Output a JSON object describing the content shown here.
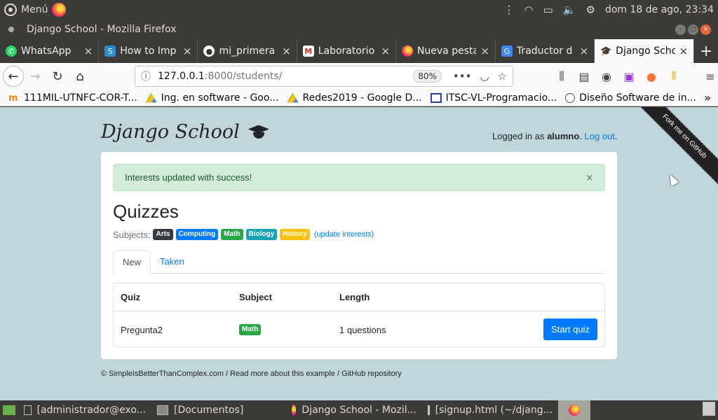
{
  "top_panel": {
    "menu_label": "Menú",
    "datetime": "dom 18 de ago, 23:34"
  },
  "window": {
    "title": "Django School - Mozilla Firefox"
  },
  "tabs": [
    {
      "label": "WhatsApp",
      "icon": "whatsapp-icon",
      "color": "#25d366"
    },
    {
      "label": "How to Imp",
      "icon": "stackoverflow-icon",
      "color": "#2d8cc8"
    },
    {
      "label": "mi_primera",
      "icon": "github-icon",
      "color": "#333333"
    },
    {
      "label": "Laboratorio",
      "icon": "gmail-icon",
      "color": "#d93025"
    },
    {
      "label": "Nueva pesta",
      "icon": "firefox-icon",
      "color": "#ff7139"
    },
    {
      "label": "Traductor d",
      "icon": "google-translate-icon",
      "color": "#4285f4"
    },
    {
      "label": "Django Scho",
      "icon": "graduation-cap-icon",
      "color": "#212529",
      "active": true
    }
  ],
  "urlbar": {
    "host": "127.0.0.1",
    "path": ":8000/students/",
    "zoom": "80%"
  },
  "bookmarks": [
    {
      "label": "111MIL-UTNFC-COR-T...",
      "icon": "moodle-icon"
    },
    {
      "label": "Ing. en software - Goo...",
      "icon": "google-drive-icon"
    },
    {
      "label": "Redes2019 - Google D...",
      "icon": "google-drive-icon"
    },
    {
      "label": "ITSC-VL-Programacio...",
      "icon": "calendar-icon"
    },
    {
      "label": "Diseño Software de in...",
      "icon": "globe-icon"
    }
  ],
  "page": {
    "brand": "Django School",
    "login_prefix": "Logged in as ",
    "username": "alumno",
    "login_sep": ". ",
    "logout": "Log out",
    "login_suffix": ".",
    "ribbon": "Fork me on GitHub",
    "alert": "Interests updated with success!",
    "alert_close": "×",
    "title": "Quizzes",
    "subjects_label": "Subjects:",
    "subjects": [
      {
        "name": "Arts",
        "color": "#343a40"
      },
      {
        "name": "Computing",
        "color": "#007bff"
      },
      {
        "name": "Math",
        "color": "#28a745"
      },
      {
        "name": "Biology",
        "color": "#17a2b8"
      },
      {
        "name": "History",
        "color": "#ffc107"
      }
    ],
    "update_interests": "(update interests)",
    "tabs": [
      {
        "label": "New",
        "active": true
      },
      {
        "label": "Taken",
        "active": false
      }
    ],
    "table": {
      "headers": [
        "Quiz",
        "Subject",
        "Length"
      ],
      "rows": [
        {
          "quiz": "Pregunta2",
          "subject": "Math",
          "subject_color": "#28a745",
          "length": "1 questions",
          "action": "Start quiz"
        }
      ]
    },
    "footer": "© SimpleIsBetterThanComplex.com / Read more about this example / GitHub repository"
  },
  "taskbar": [
    {
      "label": "[administrador@exo...",
      "icon": "terminal-icon"
    },
    {
      "label": "[Documentos]",
      "icon": "folder-icon"
    },
    {
      "label": "Django School - Mozil...",
      "icon": "firefox-icon"
    },
    {
      "label": "[signup.html (~/djang...",
      "icon": "text-editor-icon"
    }
  ]
}
